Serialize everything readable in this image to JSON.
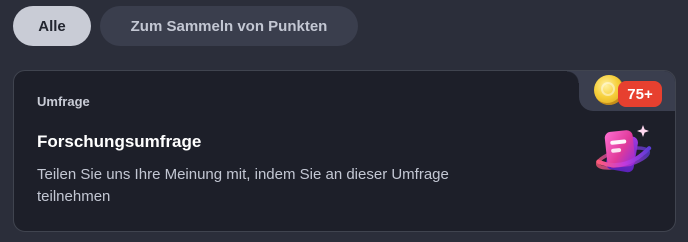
{
  "filters": {
    "all_label": "Alle",
    "collect_label": "Zum Sammeln von Punkten"
  },
  "card": {
    "category": "Umfrage",
    "title": "Forschungsumfrage",
    "description": "Teilen Sie uns Ihre Meinung mit, indem Sie an dieser Umfrage teilnehmen",
    "reward_points": "75+",
    "reward_icon": "coin-icon",
    "illustration_icon": "survey-icon"
  },
  "colors": {
    "background": "#2b2e3a",
    "card_background": "#1d1f29",
    "chip_active": "#c9ccd6",
    "chip_inactive": "#3a3e4d",
    "badge": "#e7402f",
    "coin": "#f6cf3a",
    "icon_pink": "#f0449a"
  }
}
